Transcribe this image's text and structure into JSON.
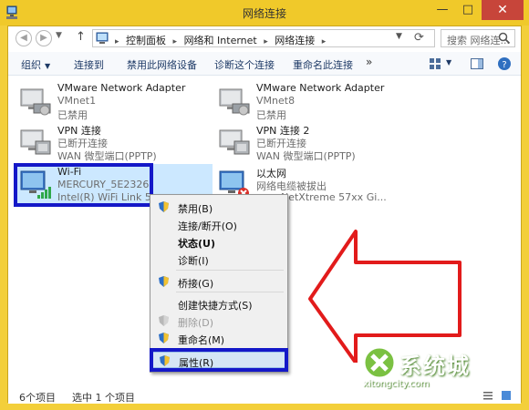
{
  "window": {
    "title": "网络连接",
    "minimize_glyph": "—",
    "maximize_glyph": "□",
    "close_glyph": "✕"
  },
  "address": {
    "crumbs": [
      "控制面板",
      "网络和 Internet",
      "网络连接"
    ],
    "search_placeholder": "搜索 网络连..."
  },
  "toolbar": {
    "items": [
      "组织",
      "连接到",
      "禁用此网络设备",
      "诊断这个连接",
      "重命名此连接"
    ],
    "more_glyph": "»"
  },
  "connections": [
    {
      "name": "VMware Network Adapter",
      "line2": "VMnet1",
      "line3": "已禁用"
    },
    {
      "name": "VMware Network Adapter",
      "line2": "VMnet8",
      "line3": "已禁用"
    },
    {
      "name": "VPN 连接",
      "line2": "已断开连接",
      "line3": "WAN 微型端口(PPTP)"
    },
    {
      "name": "VPN 连接 2",
      "line2": "已断开连接",
      "line3": "WAN 微型端口(PPTP)"
    },
    {
      "name": "Wi-Fi",
      "line2": "MERCURY_5E2326",
      "line3": "Intel(R) WiFi Link 5"
    },
    {
      "name": "以太网",
      "line2": "网络电缆被拔出",
      "line3": "com NetXtreme 57xx Gi..."
    }
  ],
  "context_menu": {
    "items": [
      {
        "label": "禁用(B)",
        "shield": true,
        "style": "normal"
      },
      {
        "label": "连接/断开(O)",
        "shield": false,
        "style": "normal"
      },
      {
        "label": "状态(U)",
        "shield": false,
        "style": "bold"
      },
      {
        "label": "诊断(I)",
        "shield": false,
        "style": "normal"
      },
      {
        "label": "桥接(G)",
        "shield": true,
        "style": "normal"
      },
      {
        "label": "创建快捷方式(S)",
        "shield": false,
        "style": "normal"
      },
      {
        "label": "删除(D)",
        "shield": true,
        "style": "disabled"
      },
      {
        "label": "重命名(M)",
        "shield": true,
        "style": "normal"
      },
      {
        "label": "属性(R)",
        "shield": true,
        "style": "highlighted"
      }
    ]
  },
  "status_bar": {
    "count": "6个项目",
    "selected": "选中 1 个项目"
  },
  "watermark": {
    "brand": "系统城",
    "url": "xitongcity.com"
  },
  "colors": {
    "window_frame": "#f3cf3a",
    "close_button": "#c7453a",
    "annotation_box": "#1418c8",
    "annotation_arrow": "#e21b1b",
    "selection": "#cce8ff"
  }
}
